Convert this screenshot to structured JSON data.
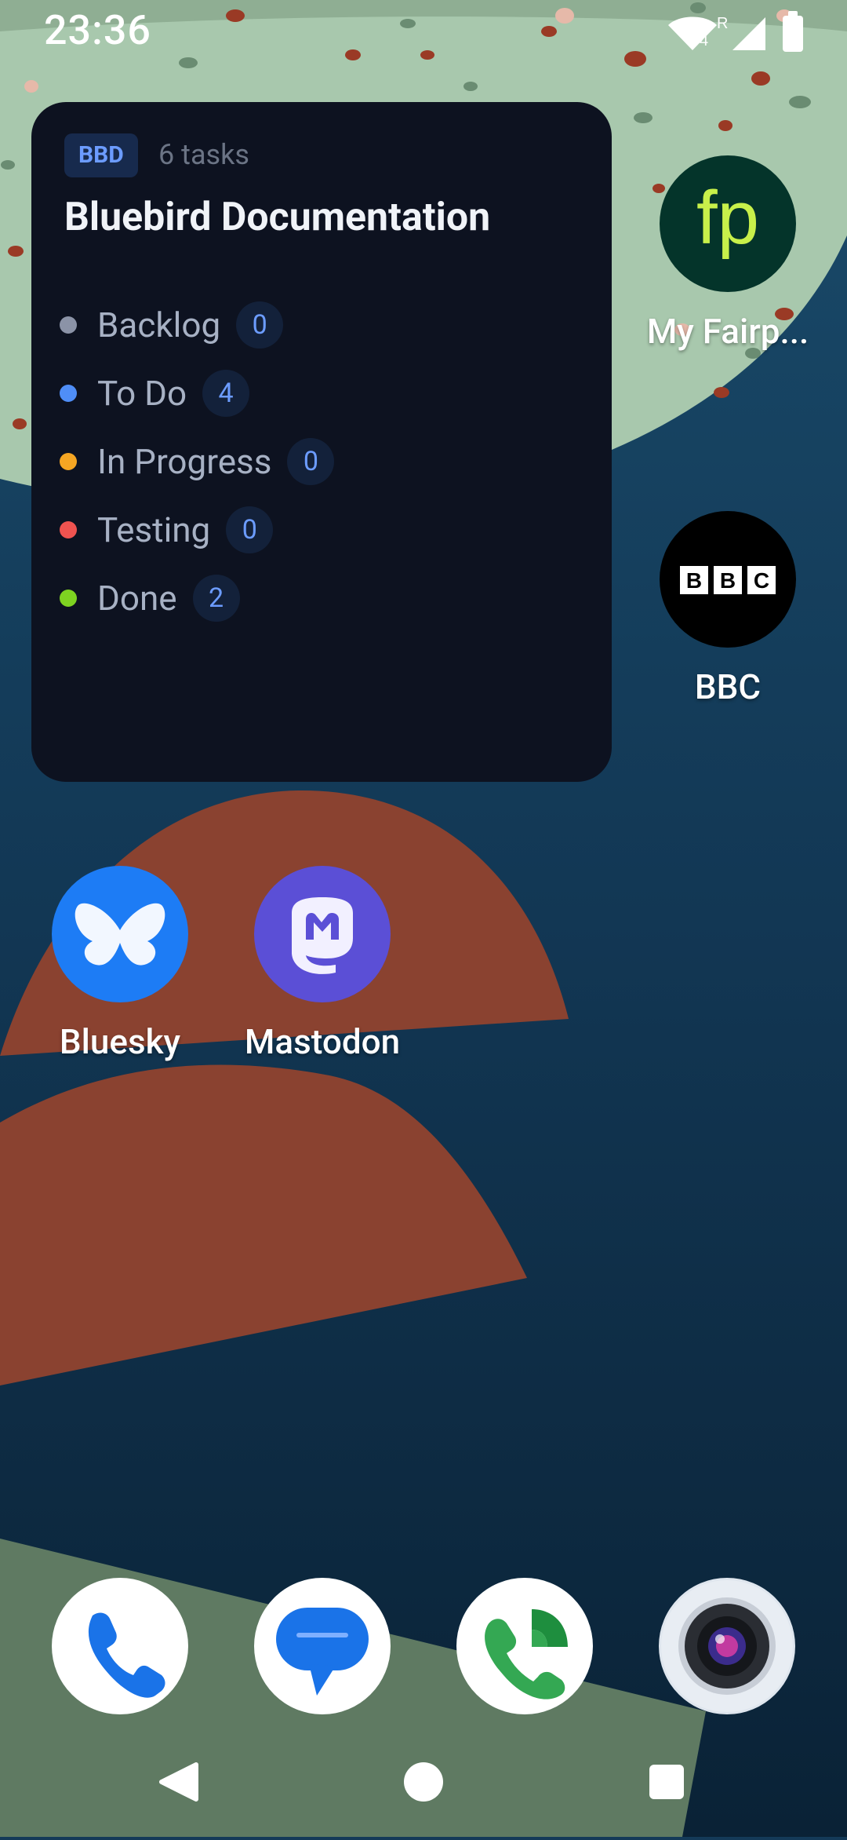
{
  "status_bar": {
    "time": "23:36",
    "network_badge": "4",
    "roaming": "R"
  },
  "widget": {
    "badge": "BBD",
    "task_count": "6 tasks",
    "title": "Bluebird Documentation",
    "statuses": [
      {
        "label": "Backlog",
        "count": "0",
        "color": "#8b93a7"
      },
      {
        "label": "To Do",
        "count": "4",
        "color": "#4f8ef7"
      },
      {
        "label": "In Progress",
        "count": "0",
        "color": "#f5a623"
      },
      {
        "label": "Testing",
        "count": "0",
        "color": "#ef5350"
      },
      {
        "label": "Done",
        "count": "2",
        "color": "#7ed321"
      }
    ]
  },
  "apps": [
    {
      "label": "My Fairp...",
      "icon": "fairphone-icon"
    },
    {
      "label": "BBC",
      "icon": "bbc-icon"
    },
    {
      "label": "Bluesky",
      "icon": "bluesky-icon"
    },
    {
      "label": "Mastodon",
      "icon": "mastodon-icon"
    }
  ],
  "dock": [
    {
      "icon": "phone-icon"
    },
    {
      "icon": "messages-icon"
    },
    {
      "icon": "call-app-icon"
    },
    {
      "icon": "camera-icon"
    }
  ],
  "colors": {
    "wallpaper_blue": "#143a58",
    "wallpaper_mint": "#a8c8ad",
    "wallpaper_rust": "#8a4230",
    "wallpaper_green": "#5f7a62",
    "widget_bg": "#0d1220",
    "accent": "#6c9cff"
  }
}
